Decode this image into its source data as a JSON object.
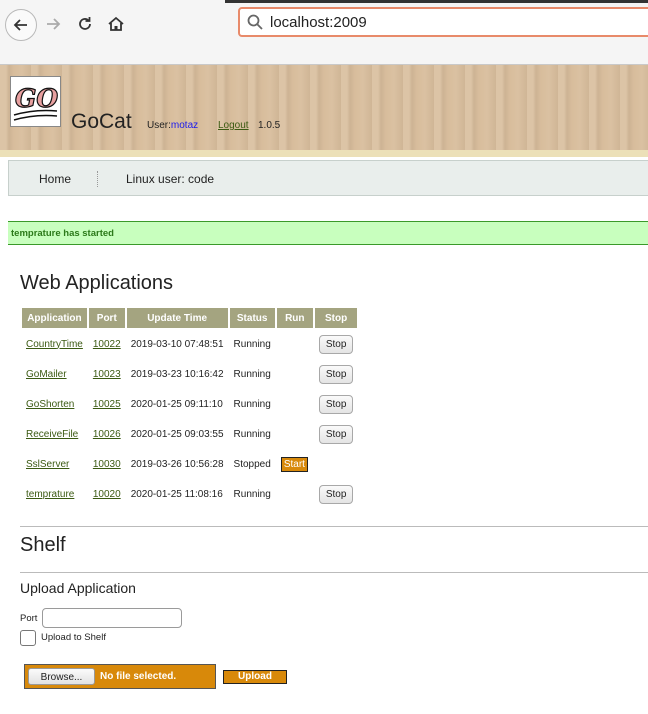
{
  "browser": {
    "url": "localhost:2009"
  },
  "header": {
    "logo_text": "GO",
    "app_name": "GoCat",
    "user_label": "User:",
    "username": "motaz",
    "logout_label": "Logout",
    "version": "1.0.5"
  },
  "nav": {
    "home_label": "Home",
    "linux_user_label": "Linux user: code"
  },
  "flash": {
    "message": "temprature has started"
  },
  "web_apps": {
    "title": "Web Applications",
    "columns": [
      "Application",
      "Port",
      "Update Time",
      "Status",
      "Run",
      "Stop"
    ],
    "rows": [
      {
        "name": "CountryTime",
        "port": "10022",
        "updated": "2019-03-10 07:48:51",
        "status": "Running",
        "action": "Stop"
      },
      {
        "name": "GoMailer",
        "port": "10023",
        "updated": "2019-03-23 10:16:42",
        "status": "Running",
        "action": "Stop"
      },
      {
        "name": "GoShorten",
        "port": "10025",
        "updated": "2020-01-25 09:11:10",
        "status": "Running",
        "action": "Stop"
      },
      {
        "name": "ReceiveFile",
        "port": "10026",
        "updated": "2020-01-25 09:03:55",
        "status": "Running",
        "action": "Stop"
      },
      {
        "name": "SslServer",
        "port": "10030",
        "updated": "2019-03-26 10:56:28",
        "status": "Stopped",
        "action": "Start"
      },
      {
        "name": "temprature",
        "port": "10020",
        "updated": "2020-01-25 11:08:16",
        "status": "Running",
        "action": "Stop"
      }
    ]
  },
  "shelf": {
    "title": "Shelf"
  },
  "upload": {
    "title": "Upload Application",
    "port_label": "Port",
    "port_value": "",
    "shelf_checkbox_label": "Upload to Shelf",
    "browse_label": "Browse...",
    "no_file_label": "No file selected.",
    "upload_label": "Upload"
  },
  "colors": {
    "table_header": "#a4a480",
    "running": "#2d8a14",
    "stopped": "#d40000",
    "accent_orange": "#d8890a",
    "flash_bg": "#c8ffbe",
    "link": "#3b5a12"
  }
}
